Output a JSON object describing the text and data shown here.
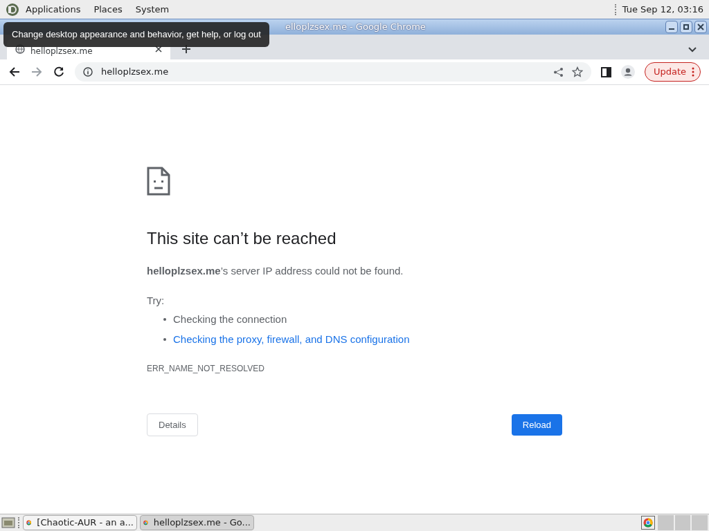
{
  "top_panel": {
    "menus": [
      "Applications",
      "Places",
      "System"
    ],
    "clock": "Tue Sep 12, 03:16"
  },
  "tooltip": "Change desktop appearance and behavior, get help, or log out",
  "window": {
    "title": "elloplzsex.me - Google Chrome"
  },
  "tabs": [
    {
      "label": "helloplzsex.me",
      "selected": true
    }
  ],
  "toolbar": {
    "url": "helloplzsex.me",
    "update_button": "Update"
  },
  "error_page": {
    "heading": "This site can’t be reached",
    "message": "**helloplzsex.me**’s server IP address could not be found.",
    "try_label": "Try:",
    "suggestions": [
      {
        "text": "Checking the connection",
        "kind": "text"
      },
      {
        "text": "Checking the proxy, firewall, and DNS configuration",
        "kind": "link"
      }
    ],
    "error_code": "ERR_NAME_NOT_RESOLVED",
    "details_button": "Details",
    "reload_button": "Reload"
  },
  "taskbar": {
    "items": [
      {
        "label": "[Chaotic-AUR - an a...",
        "selected": false
      },
      {
        "label": "helloplzsex.me - Go...",
        "selected": true
      }
    ]
  }
}
